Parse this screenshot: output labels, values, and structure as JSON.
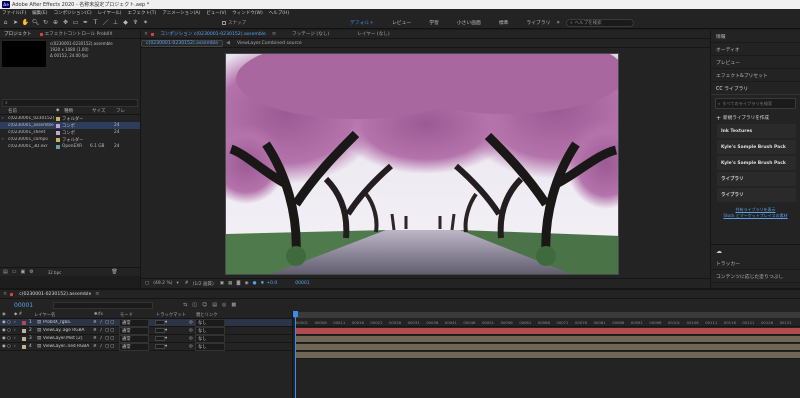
{
  "app": {
    "logo_text": "Ae",
    "title": "Adobe After Effects 2020 - 名称未設定プロジェクト.aep *"
  },
  "menu": [
    "ファイル(F)",
    "編集(E)",
    "コンポジション(C)",
    "レイヤー(L)",
    "エフェクト(T)",
    "アニメーション(A)",
    "ビュー(V)",
    "ウィンドウ(W)",
    "ヘルプ(H)"
  ],
  "toolbar": {
    "snap_label": "スナップ",
    "workspaces": [
      "デフォルト",
      "レビュー",
      "学習",
      "小さい画面",
      "標準",
      "ライブラリ"
    ],
    "active_workspace": 0,
    "search_placeholder": "ヘルプを検索"
  },
  "project_panel": {
    "tabs": [
      "プロジェクト",
      "エフェクトコントロール ProbllX"
    ],
    "info": [
      "c(0230001-0230152).assemble",
      "1920 x 1080 (1.00)",
      "Δ 00152, 24.00 fps"
    ],
    "columns": [
      "名前",
      "種類",
      "サイズ",
      "フレ"
    ],
    "rows": [
      {
        "name": "c(0230001_0230152)",
        "type": "フォルダー",
        "size": "",
        "fps": "",
        "color": "#c7b164"
      },
      {
        "name": "c(0230001_assemble",
        "type": "コンポ",
        "size": "",
        "fps": "24",
        "color": "#c0a6c9"
      },
      {
        "name": "c(0230001_sheet",
        "type": "コンポ",
        "size": "",
        "fps": "24",
        "color": "#c0a6c9"
      },
      {
        "name": "c(0230001_compo",
        "type": "フォルダー",
        "size": "",
        "fps": "",
        "color": "#c7b164"
      },
      {
        "name": "c(0230001_3D.exr",
        "type": "OpenEXR",
        "size": "6.1 GB",
        "fps": "24",
        "color": "#6a9fb0"
      }
    ],
    "bpc": "32 bpc"
  },
  "comp_panel": {
    "tabs": [
      "コンポジション c(0230001-0230152).assemble",
      "フッテージ (なし)",
      "レイヤー (なし)"
    ],
    "subtabs": [
      "c(0230001-0230152).assemble",
      "ViewLayer.Combined source"
    ],
    "zoom": "(49.2 %)",
    "resolution": "(1/2 画質)",
    "exposure": "+0.0",
    "timecode": "00001"
  },
  "right_panel": {
    "top_items": [
      "情報",
      "オーディオ",
      "プレビュー",
      "エフェクト&プリセット"
    ],
    "libraries_tab": "CC ライブラリ",
    "lib_search": "すべてのライブラリを検索",
    "create_label": "新規ライブラリを作成",
    "libraries": [
      "Ink Textures",
      "Kyle's Sample Brush Pack",
      "Kyle's Sample Brush Pack",
      "ライブラリ",
      "ライブラリ"
    ],
    "links": [
      "共有ライブラリを表示",
      "Stock とマーケットプレイスの素材"
    ],
    "tracker": "トラッカー",
    "content_aware": "コンテンツに応じた塗りつぶし"
  },
  "timeline": {
    "tab": "c(0230001-0230152).assemble",
    "timecode": "00001",
    "columns": [
      "レイヤー名",
      "モード",
      "トラックマット",
      "親とリンク"
    ],
    "layers": [
      {
        "num": "1",
        "name": "ProbllX_rgba.",
        "mode": "通常",
        "parent": "なし",
        "color": "#b3494b",
        "bar": "#b24b4e"
      },
      {
        "num": "2",
        "name": "ViewLay..age RGBA",
        "mode": "通常",
        "parent": "なし",
        "color": "#bdb396",
        "bar": "#6f6656"
      },
      {
        "num": "3",
        "name": "ViewLayer.Mist [2]",
        "mode": "通常",
        "parent": "なし",
        "color": "#bdb396",
        "bar": "#6f6656"
      },
      {
        "num": "4",
        "name": "ViewLayer..ned RGBA",
        "mode": "通常",
        "parent": "なし",
        "color": "#bdb396",
        "bar": "#6f6656"
      }
    ],
    "ticks": [
      "00001",
      "00006",
      "00011",
      "00016",
      "00021",
      "00026",
      "00031",
      "00036",
      "00041",
      "00046",
      "00051",
      "00056",
      "00061",
      "00066",
      "00071",
      "00076",
      "00081",
      "00086",
      "00091",
      "00096",
      "00101",
      "00106",
      "00111",
      "00116",
      "00121",
      "00126",
      "00131"
    ]
  }
}
